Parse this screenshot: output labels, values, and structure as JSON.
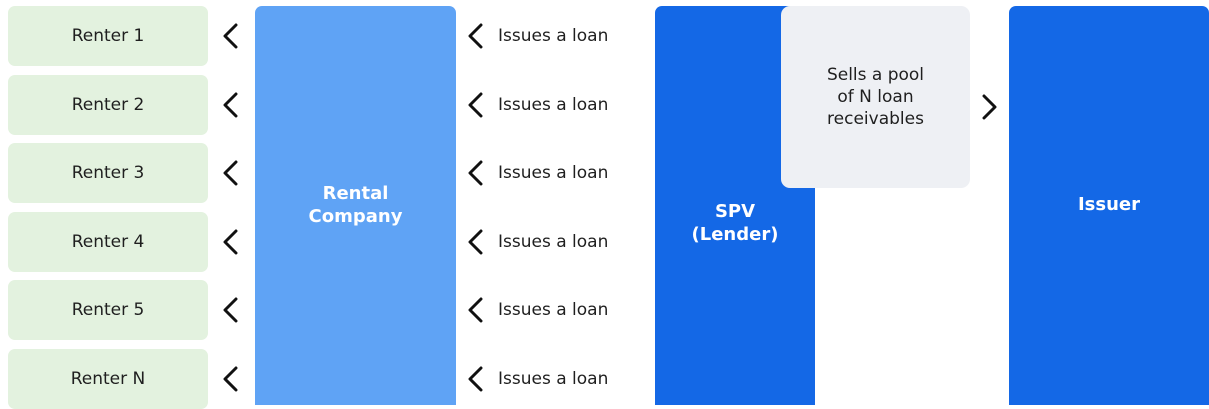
{
  "renters": [
    {
      "label": "Renter 1"
    },
    {
      "label": "Renter 2"
    },
    {
      "label": "Renter 3"
    },
    {
      "label": "Renter 4"
    },
    {
      "label": "Renter 5"
    },
    {
      "label": "Renter N"
    }
  ],
  "rental_company": {
    "line1": "Rental",
    "line2": "Company"
  },
  "loans": [
    {
      "label": "Issues a loan"
    },
    {
      "label": "Issues a loan"
    },
    {
      "label": "Issues a loan"
    },
    {
      "label": "Issues a loan"
    },
    {
      "label": "Issues a loan"
    },
    {
      "label": "Issues a loan"
    }
  ],
  "spv": {
    "line1": "SPV",
    "line2": "(Lender)"
  },
  "sale_note": {
    "line1": "Sells a pool",
    "line2": "of N loan",
    "line3": "receivables"
  },
  "issuer": {
    "label": "Issuer"
  },
  "colors": {
    "renter_fill": "#e3f2df",
    "rental_company_fill": "#5fa3f5",
    "spv_fill": "#1468e6",
    "issuer_fill": "#1468e6",
    "note_fill": "#eef0f4"
  },
  "icons": {
    "flow_left": "chevron-left-icon",
    "flow_right": "chevron-right-icon"
  }
}
